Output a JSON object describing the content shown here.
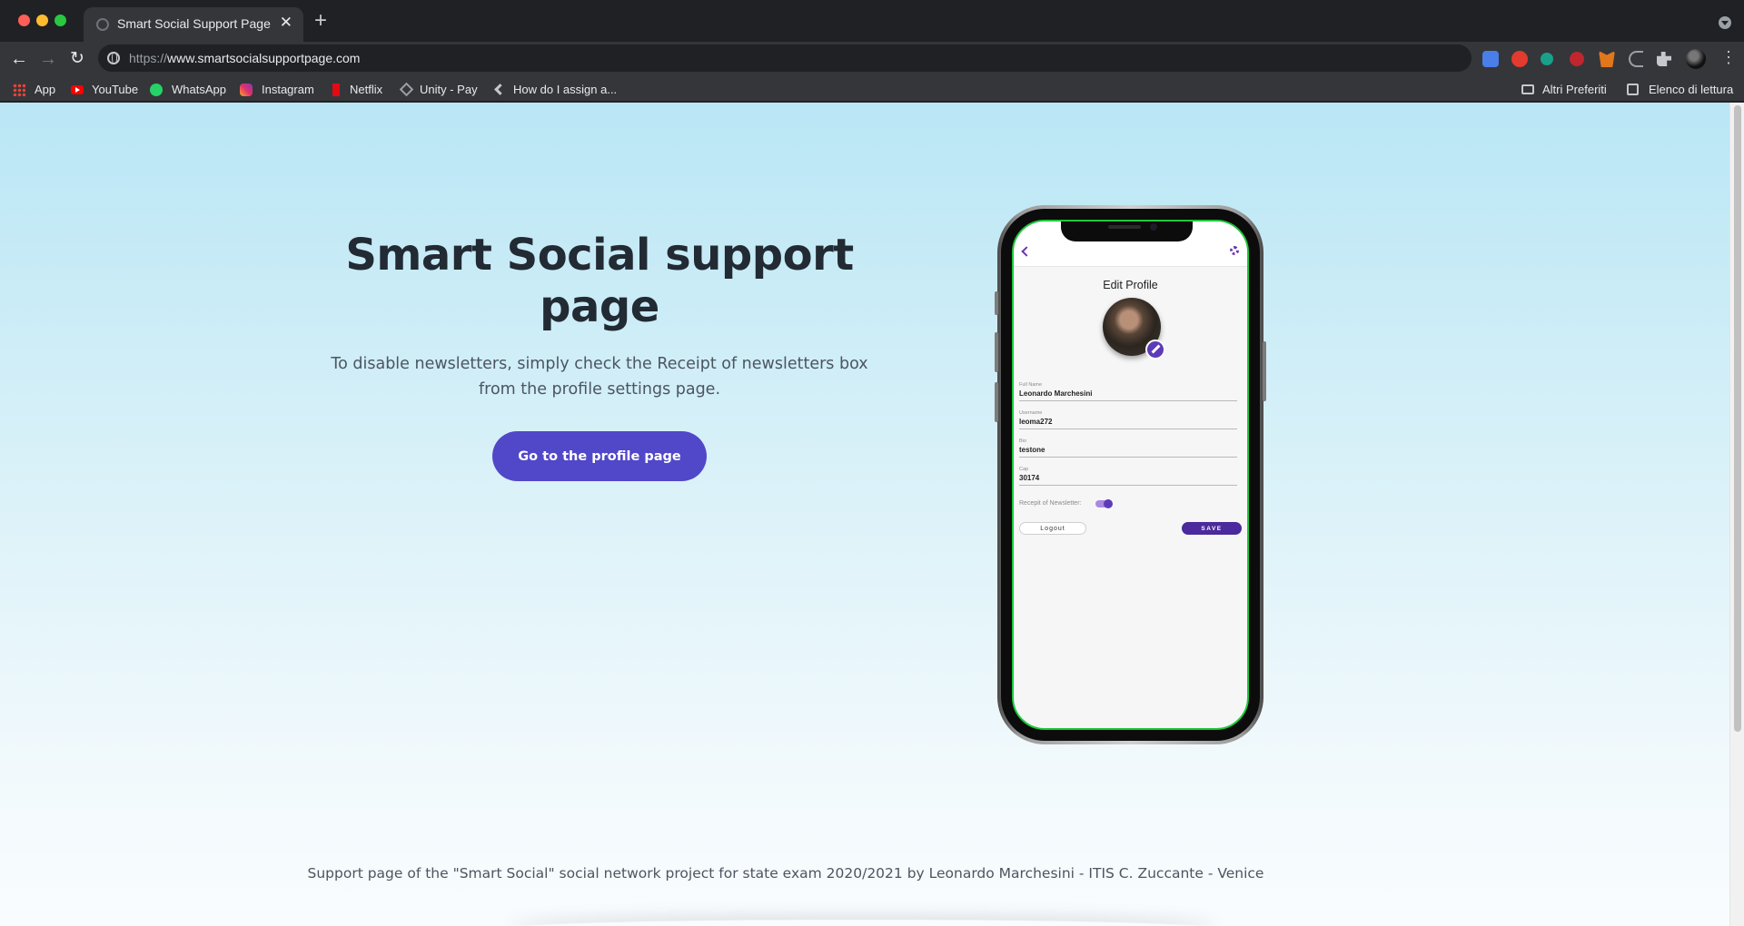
{
  "browser": {
    "tab_title": "Smart Social Support Page",
    "tab_close": "✕",
    "new_tab": "+",
    "url_scheme": "https://",
    "url_host": "www.smartsocialsupportpage.com",
    "nav": {
      "back": "←",
      "forward": "→",
      "reload": "↻"
    },
    "menu": "⋮",
    "bookmarks": [
      {
        "label": "App",
        "icon": "apps-grid-icon"
      },
      {
        "label": "YouTube",
        "icon": "youtube-icon"
      },
      {
        "label": "WhatsApp",
        "icon": "whatsapp-icon"
      },
      {
        "label": "Instagram",
        "icon": "instagram-icon"
      },
      {
        "label": "Netflix",
        "icon": "netflix-icon"
      },
      {
        "label": "Unity - Pay",
        "icon": "unity-icon"
      },
      {
        "label": "How do I assign a...",
        "icon": "visual-studio-icon"
      }
    ],
    "other_bookmarks": "Altri Preferiti",
    "reading_list": "Elenco di lettura"
  },
  "hero": {
    "title": "Smart Social support page",
    "subtitle": "To disable newsletters, simply check the Receipt of newsletters box from the profile settings page.",
    "cta_label": "Go to the profile page"
  },
  "phone_app": {
    "screen_title": "Edit Profile",
    "fields": [
      {
        "label": "Full Name",
        "value": "Leonardo Marchesini"
      },
      {
        "label": "Username",
        "value": "leoma272"
      },
      {
        "label": "Bio",
        "value": "testone"
      },
      {
        "label": "Cap",
        "value": "30174"
      }
    ],
    "newsletter_label": "Recepit of Newsletter:",
    "newsletter_enabled": true,
    "logout_label": "Logout",
    "save_label": "SAVE",
    "accent_color": "#5d3bb8"
  },
  "footer": {
    "text": "Support page of the \"Smart Social\" social network project for state exam 2020/2021 by Leonardo Marchesini - ITIS C. Zuccante - Venice"
  },
  "colors": {
    "cta_background": "#5147c9",
    "title_text": "#222a33",
    "page_gradient_top": "#b9e6f5"
  }
}
